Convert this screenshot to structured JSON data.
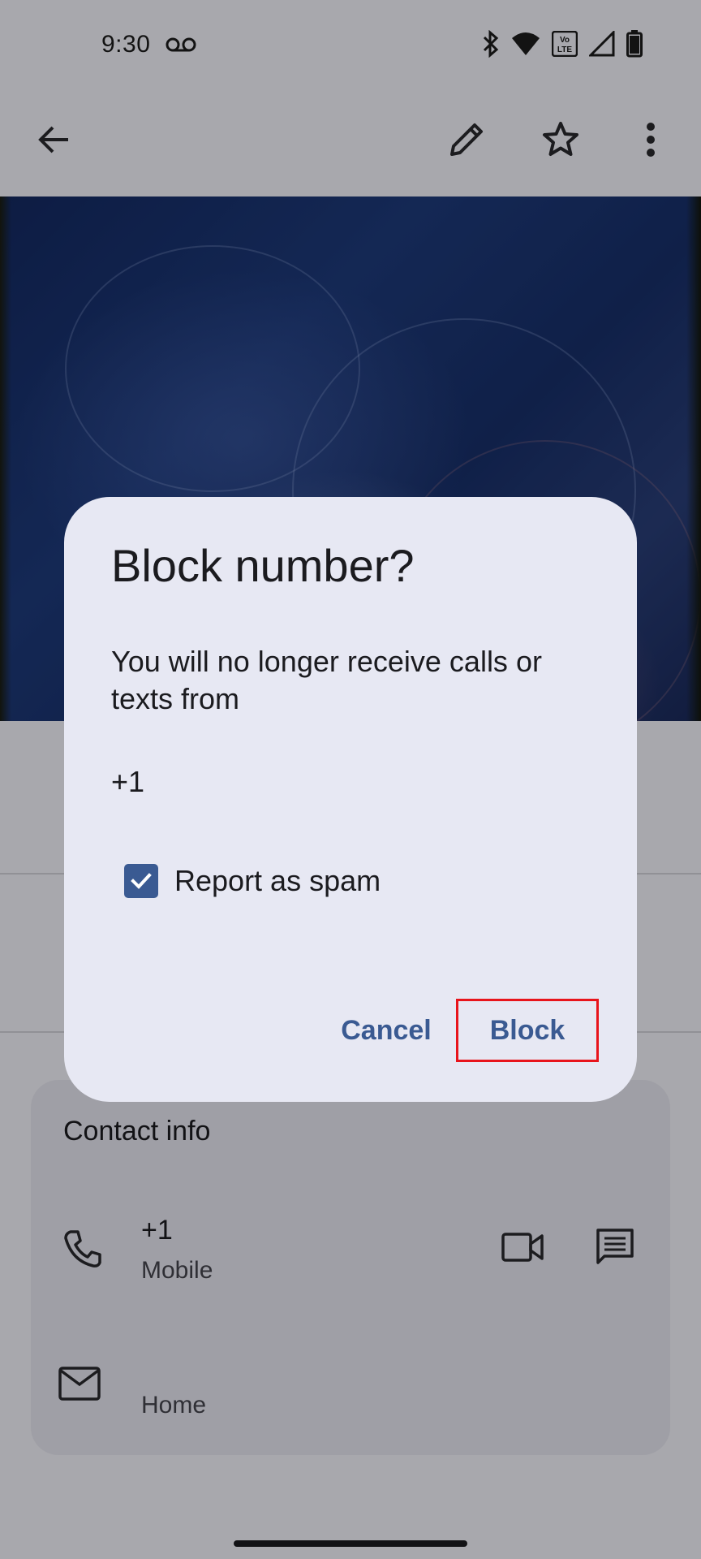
{
  "status_bar": {
    "time": "9:30",
    "icons": [
      "voicemail-icon",
      "bluetooth-icon",
      "wifi-icon",
      "volte-icon",
      "signal-icon",
      "battery-icon"
    ]
  },
  "app_bar": {
    "icons": [
      "back-arrow-icon",
      "edit-pencil-icon",
      "star-icon",
      "more-vert-icon"
    ]
  },
  "contact_info": {
    "title": "Contact info",
    "phone": {
      "number": "+1",
      "type": "Mobile",
      "icons": [
        "phone-icon",
        "video-call-icon",
        "message-icon"
      ]
    },
    "email": {
      "type": "Home",
      "icon": "email-icon"
    }
  },
  "dialog": {
    "title": "Block number?",
    "body": "You will no longer receive calls or texts from",
    "number": "+1",
    "checkbox_label": "Report as spam",
    "checkbox_checked": true,
    "cancel_label": "Cancel",
    "block_label": "Block",
    "accent_color": "#3a5a92",
    "highlight_color": "#e8141b"
  }
}
